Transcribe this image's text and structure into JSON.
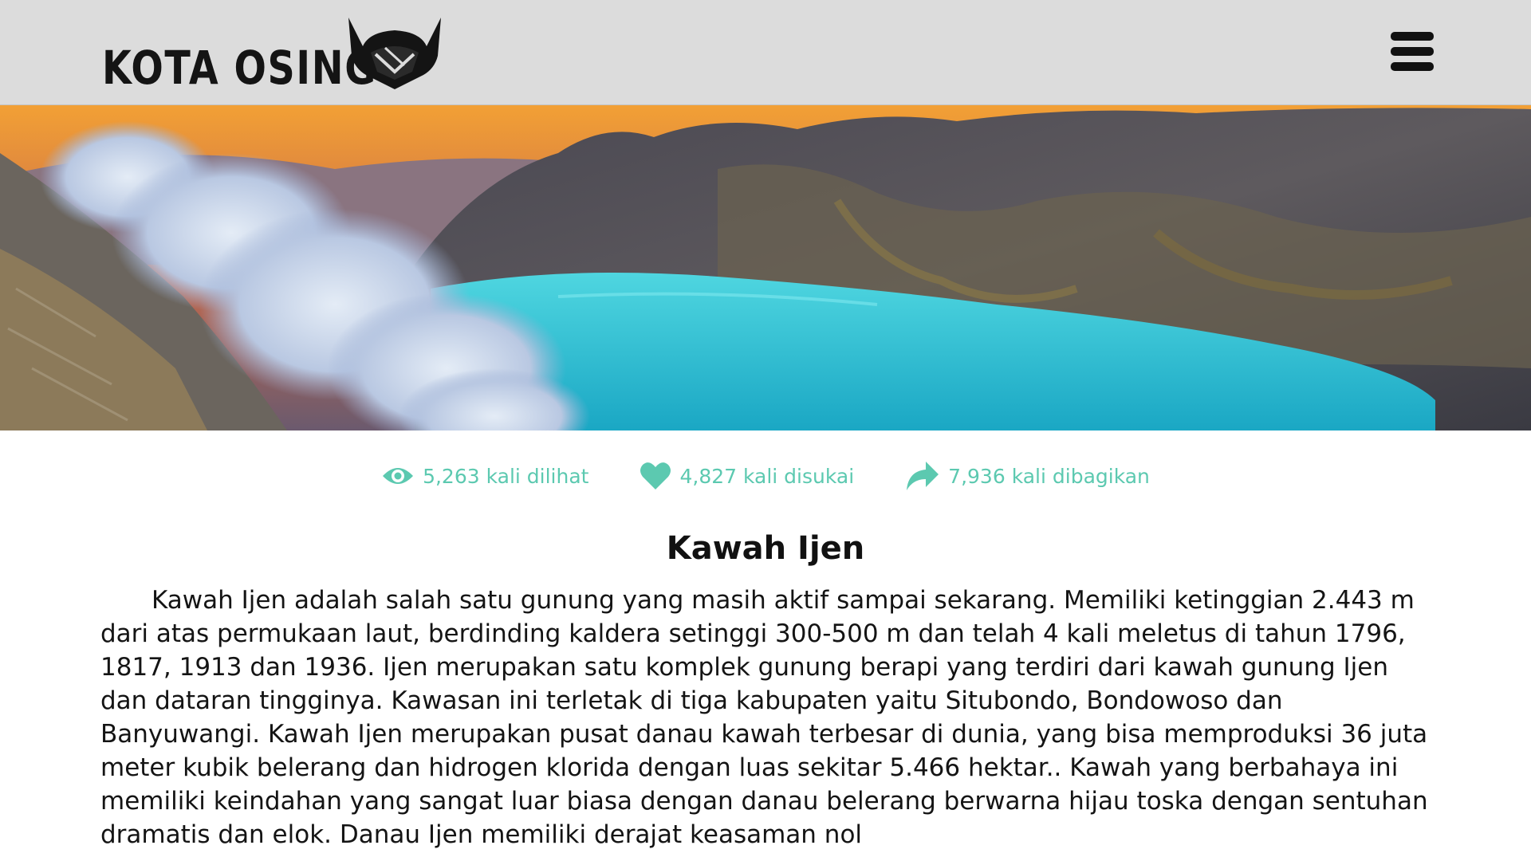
{
  "header": {
    "logo_text": "KOTA OSING",
    "logo_mark": "horned-helmet-logo",
    "menu_icon": "hamburger-menu-icon"
  },
  "hero": {
    "image": "crater-lake-photo"
  },
  "stats": {
    "views": {
      "icon": "eye-icon",
      "label": "5,263 kali dilihat"
    },
    "likes": {
      "icon": "heart-icon",
      "label": "4,827 kali disukai"
    },
    "shares": {
      "icon": "share-arrow-icon",
      "label": "7,936 kali dibagikan"
    },
    "color": "#5cc9b0"
  },
  "article": {
    "title": "Kawah Ijen",
    "body": "Kawah Ijen adalah salah satu gunung yang masih aktif sampai sekarang. Memiliki ketinggian 2.443 m dari atas permukaan laut, berdinding kaldera setinggi 300-500 m dan telah 4 kali meletus di tahun 1796, 1817, 1913 dan 1936. Ijen merupakan satu komplek gunung berapi yang terdiri dari kawah gunung Ijen dan dataran tingginya. Kawasan ini terletak di tiga kabupaten yaitu Situbondo, Bondowoso dan Banyuwangi. Kawah Ijen merupakan pusat danau kawah terbesar di dunia, yang bisa memproduksi 36 juta meter kubik belerang dan hidrogen klorida dengan luas sekitar 5.466 hektar.. Kawah yang berbahaya ini memiliki keindahan yang sangat luar biasa dengan danau belerang berwarna hijau toska dengan sentuhan dramatis dan elok. Danau Ijen memiliki derajat keasaman nol"
  }
}
